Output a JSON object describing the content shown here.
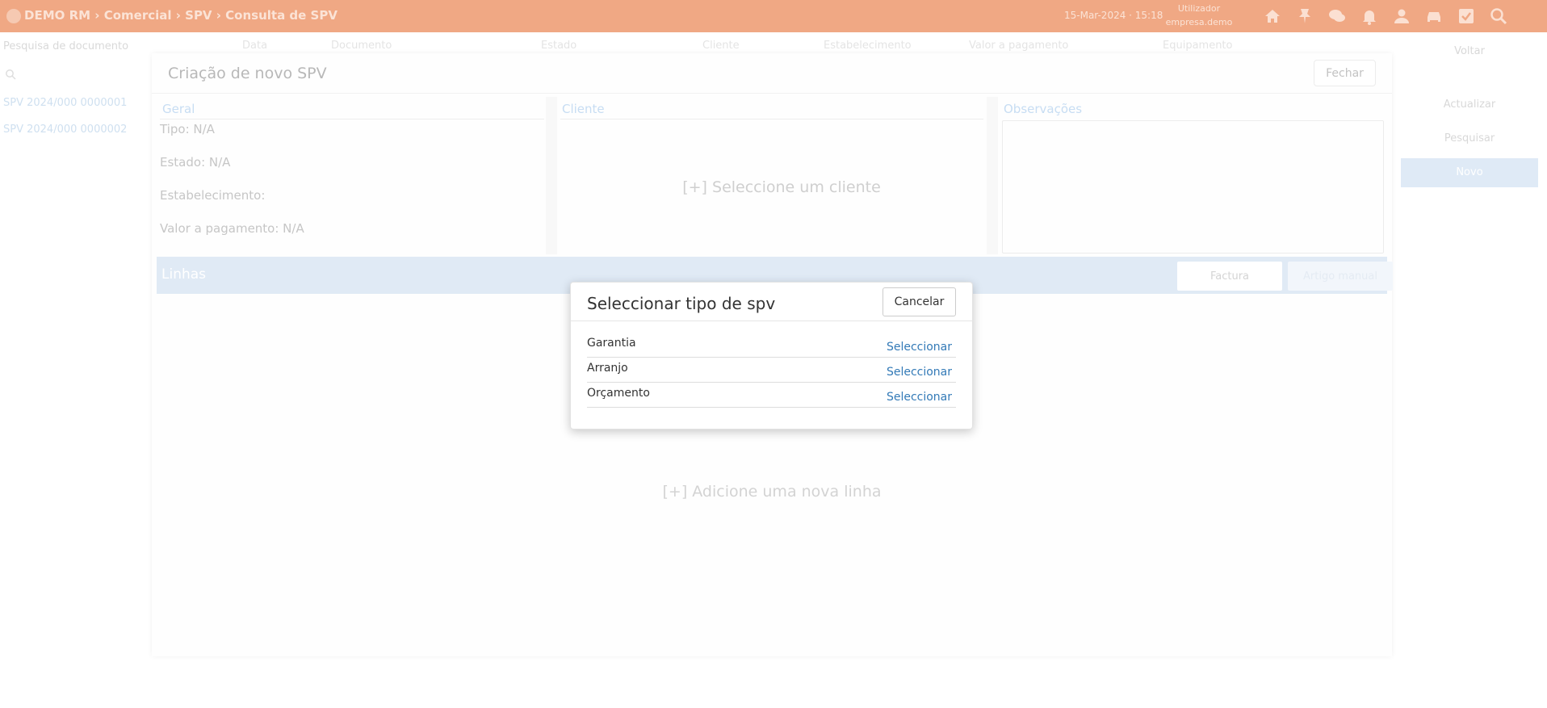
{
  "app": {
    "breadcrumb": "DEMO RM › Comercial › SPV › Consulta de SPV",
    "date": "15-Mar-2024 · 15:18",
    "user_line1": "Utilizador",
    "user_line2": "empresa.demo"
  },
  "doc_search": {
    "label": "Pesquisa de documento",
    "items": [
      "SPV 2024/000 0000001",
      "SPV 2024/000 0000002"
    ]
  },
  "grid_headers": [
    "Data",
    "Documento",
    "Estado",
    "Cliente",
    "Estabelecimento",
    "Valor a pagamento",
    "Equipamento"
  ],
  "right_panel": {
    "items": [
      "Voltar",
      "Actualizar",
      "Pesquisar"
    ],
    "active": "Novo"
  },
  "panel": {
    "title": "Criação de novo SPV",
    "close_label": "Fechar",
    "geral": {
      "label": "Geral",
      "tipo": "Tipo: N/A",
      "estado": "Estado: N/A",
      "estabelecimento": "Estabelecimento:",
      "valor": "Valor a pagamento: N/A"
    },
    "cliente": {
      "label": "Cliente",
      "placeholder": "[+] Seleccione um cliente"
    },
    "observacoes": {
      "label": "Observações"
    },
    "linhas": {
      "label": "Linhas",
      "factura_label": "Factura",
      "artigo_label": "Artigo manual",
      "add_line": "[+] Adicione uma nova linha"
    }
  },
  "modal": {
    "title": "Seleccionar tipo de spv",
    "cancel_label": "Cancelar",
    "options": [
      {
        "label": "Garantia",
        "action": "Seleccionar"
      },
      {
        "label": "Arranjo",
        "action": "Seleccionar"
      },
      {
        "label": "Orçamento",
        "action": "Seleccionar"
      }
    ]
  },
  "icons": [
    "home-icon",
    "pin-icon",
    "chat-icon",
    "bell-icon",
    "user-icon",
    "car-icon",
    "checkbox-icon",
    "search-icon"
  ],
  "colors": {
    "topbar": "#f0a884",
    "link": "#337ab7",
    "linhas_bar": "#e0eaf5"
  }
}
